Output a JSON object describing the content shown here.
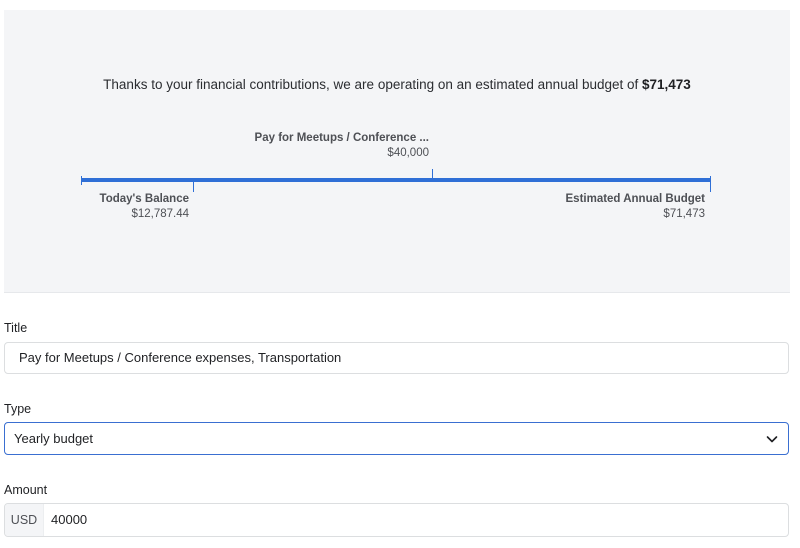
{
  "budget": {
    "summary_text": "Thanks to your financial contributions, we are operating on an estimated annual budget of ",
    "summary_amount": "$71,473",
    "goal": {
      "label": "Pay for Meetups / Conference ...",
      "amount": "$40,000"
    },
    "balance": {
      "label": "Today's Balance",
      "amount": "$12,787.44"
    },
    "estimated": {
      "label": "Estimated Annual Budget",
      "amount": "$71,473"
    },
    "bar_color": "#2f6fd6"
  },
  "form": {
    "title": {
      "label": "Title",
      "value": "Pay for Meetups / Conference expenses, Transportation"
    },
    "type": {
      "label": "Type",
      "value": "Yearly budget",
      "icon": "chevron-down-icon"
    },
    "amount": {
      "label": "Amount",
      "currency": "USD",
      "value": "40000"
    }
  }
}
